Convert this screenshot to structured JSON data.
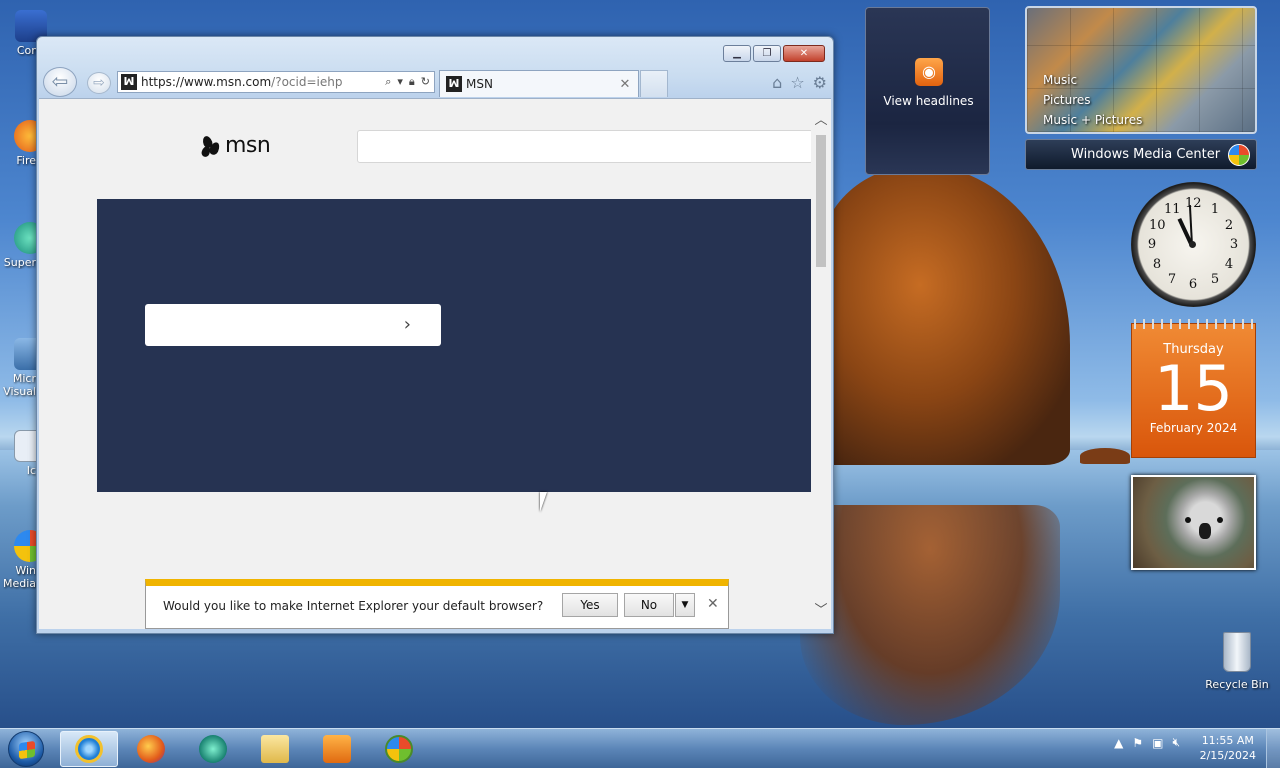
{
  "desktop": {
    "icons": [
      {
        "label": "Com"
      },
      {
        "label": "Fire"
      },
      {
        "label": "Super"
      },
      {
        "label": "Micr"
      },
      {
        "label": "Visual"
      },
      {
        "label": "Ic"
      },
      {
        "label": "Win"
      },
      {
        "label": "Media"
      }
    ],
    "recycle_bin_label": "Recycle Bin"
  },
  "browser": {
    "url_main": "https://www.msn.com",
    "url_rest": "/?ocid=iehp",
    "tab_title": "MSN",
    "favicon": "ꟽ",
    "page": {
      "logo_text": "msn"
    },
    "notification": {
      "text": "Would you like to make Internet Explorer your default browser?",
      "yes_label": "Yes",
      "no_label": "No"
    }
  },
  "gadgets": {
    "feed_headlines_label": "View headlines",
    "media_center_items": [
      "Music",
      "Pictures",
      "Music + Pictures"
    ],
    "media_center_title": "Windows Media Center",
    "clock_numbers": [
      "12",
      "1",
      "2",
      "3",
      "4",
      "5",
      "6",
      "7",
      "8",
      "9",
      "10",
      "11"
    ],
    "calendar": {
      "weekday": "Thursday",
      "day": "15",
      "month_year": "February 2024"
    }
  },
  "taskbar": {
    "time": "11:55 AM",
    "date": "2/15/2024"
  }
}
